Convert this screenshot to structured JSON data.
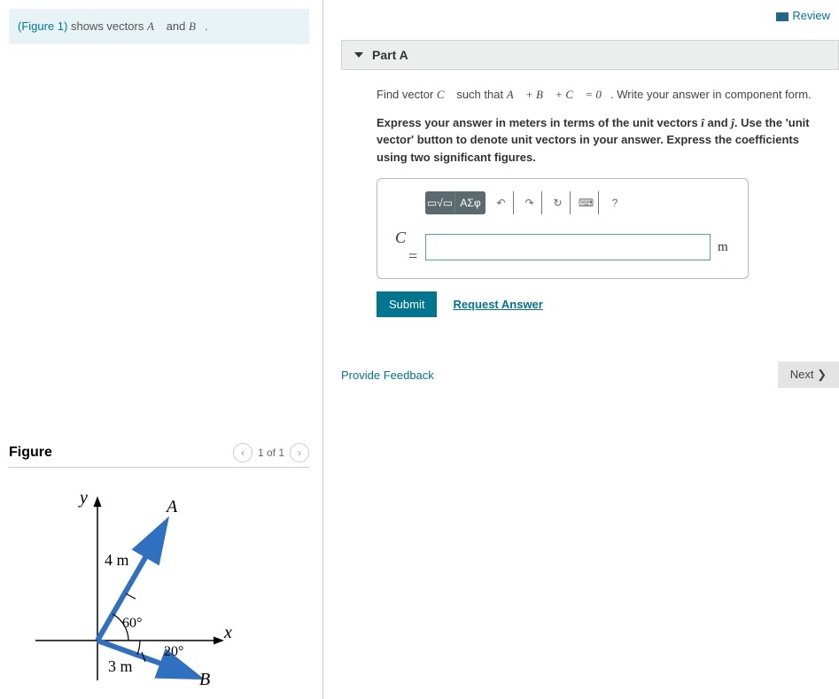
{
  "left": {
    "figure_link": "(Figure 1)",
    "intro_pre": " shows vectors ",
    "vecA": "A⃗",
    "intro_mid": " and ",
    "vecB": "B⃗",
    "intro_end": "."
  },
  "figure": {
    "title": "Figure",
    "pager": "1 of 1",
    "labels": {
      "y": "y",
      "x": "x",
      "A": "A",
      "B": "B",
      "lenA": "4 m",
      "lenB": "3 m",
      "angA": "60°",
      "angB": "20°"
    }
  },
  "right": {
    "review": "Review",
    "part_label": "Part A",
    "prompt_pre": "Find vector ",
    "vecC": "C⃗",
    "prompt_mid": " such that ",
    "eq": "A⃗ + B⃗ + C⃗ = 0⃗",
    "prompt_post": ". Write your answer in component form.",
    "instr_pre": "Express your answer in meters in terms of the unit vectors ",
    "ihat": "î",
    "and": " and ",
    "jhat": "ĵ",
    "instr_post": ". Use the 'unit vector' button to denote unit vectors in your answer. Express the coefficients using two significant figures.",
    "toolbar": {
      "tpl": "▭√▭",
      "greek": "ΑΣφ",
      "undo": "↶",
      "redo": "↷",
      "reset": "↻",
      "kbd": "⌨",
      "help": "?"
    },
    "c_equals": "C⃗ =",
    "unit": "m",
    "submit": "Submit",
    "request": "Request Answer",
    "feedback": "Provide Feedback",
    "next": "Next ❯"
  },
  "chart_data": {
    "type": "diagram",
    "description": "Two vectors from origin on xy axes",
    "vectors": [
      {
        "name": "A",
        "magnitude_m": 4,
        "angle_deg_from_x": 60
      },
      {
        "name": "B",
        "magnitude_m": 3,
        "angle_deg_from_x": -20
      }
    ],
    "axes": [
      "x",
      "y"
    ]
  }
}
